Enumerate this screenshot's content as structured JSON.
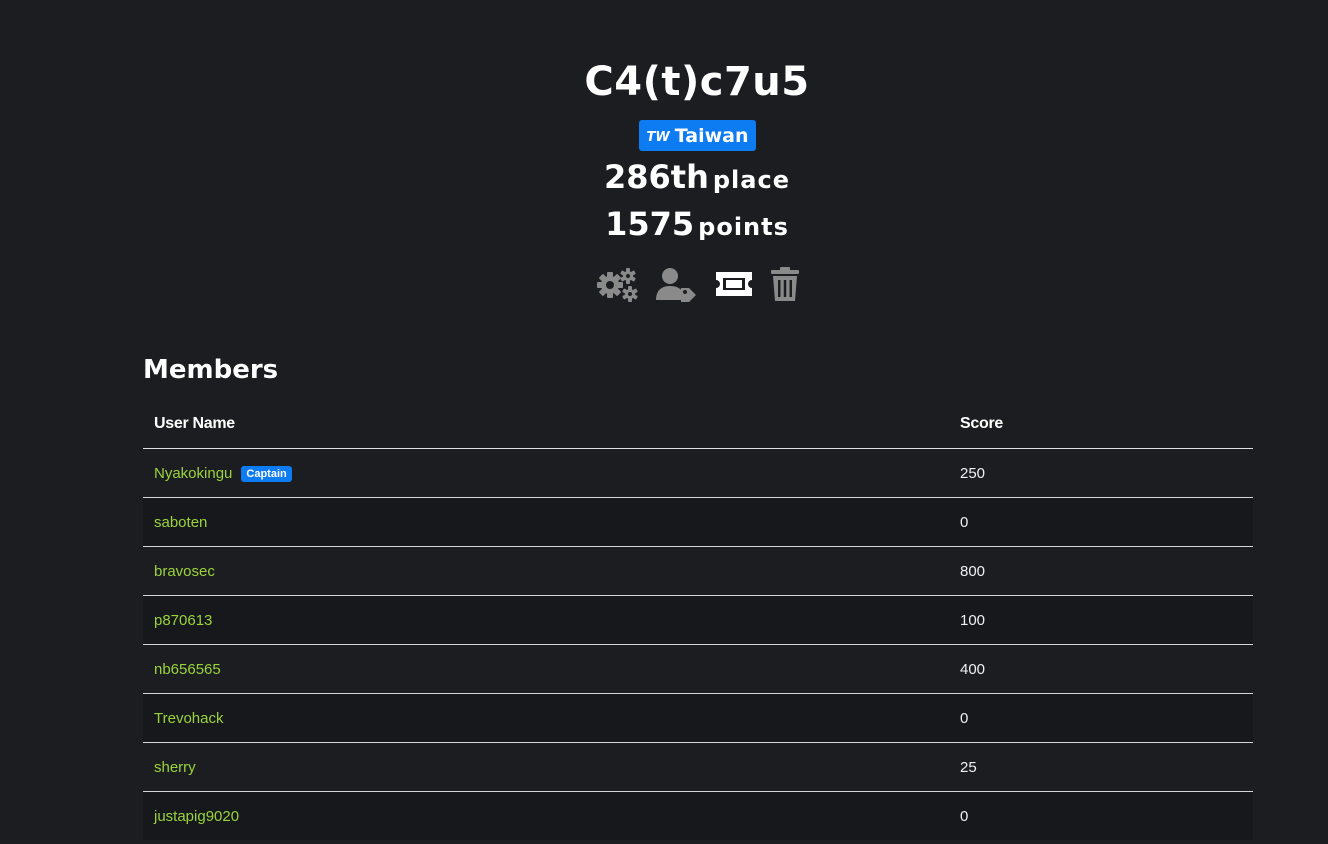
{
  "team": {
    "name": "C4(t)c7u5",
    "country_code": "TW",
    "country_name": "Taiwan",
    "place_value": "286th",
    "place_label": "place",
    "points_value": "1575",
    "points_label": "points"
  },
  "actions": [
    {
      "icon": "settings-gears-icon"
    },
    {
      "icon": "user-tag-icon"
    },
    {
      "icon": "ticket-icon"
    },
    {
      "icon": "trash-icon"
    }
  ],
  "members": {
    "title": "Members",
    "columns": {
      "user": "User Name",
      "score": "Score"
    },
    "captain_label": "Captain",
    "rows": [
      {
        "name": "Nyakokingu",
        "score": "250",
        "captain": true
      },
      {
        "name": "saboten",
        "score": "0"
      },
      {
        "name": "bravosec",
        "score": "800"
      },
      {
        "name": "p870613",
        "score": "100"
      },
      {
        "name": "nb656565",
        "score": "400"
      },
      {
        "name": "Trevohack",
        "score": "0"
      },
      {
        "name": "sherry",
        "score": "25"
      },
      {
        "name": "justapig9020",
        "score": "0"
      }
    ]
  },
  "colors": {
    "background": "#1b1d21",
    "accent_blue": "#0d7bf2",
    "username_green": "#9ad43a",
    "icon_gray": "#8a8a8a"
  }
}
